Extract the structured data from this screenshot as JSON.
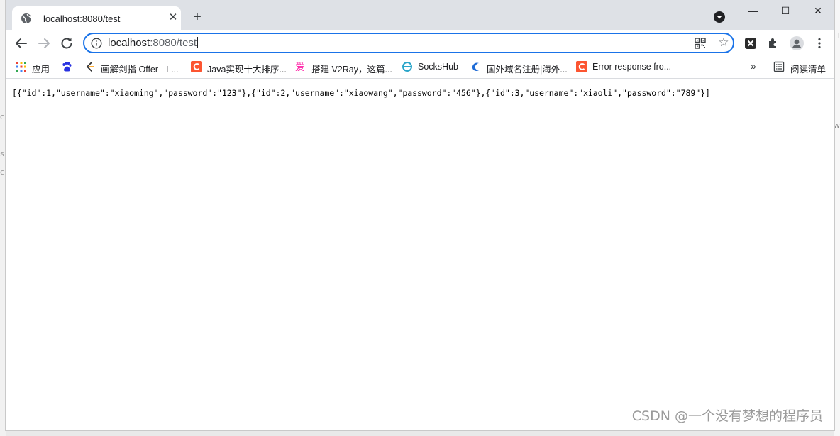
{
  "tab": {
    "title": "localhost:8080/test",
    "close_glyph": "✕"
  },
  "new_tab_glyph": "+",
  "window_controls": {
    "minimize": "—",
    "maximize": "☐",
    "close": "✕"
  },
  "address_bar": {
    "host": "localhost",
    "path": ":8080/test"
  },
  "bookmarks": [
    {
      "label": "应用",
      "icon": "apps-grid-icon"
    },
    {
      "label": "",
      "icon": "baidu-paw-icon"
    },
    {
      "label": "画解剑指 Offer - L...",
      "icon": "leetcode-icon"
    },
    {
      "label": "Java实现十大排序...",
      "icon": "csdn-icon"
    },
    {
      "label": "搭建 V2Ray，这篇...",
      "icon": "love-icon"
    },
    {
      "label": "SocksHub",
      "icon": "sockshub-icon"
    },
    {
      "label": "国外域名注册|海外...",
      "icon": "domain-icon"
    },
    {
      "label": "Error response fro...",
      "icon": "csdn-icon"
    }
  ],
  "bookmarks_overflow": "»",
  "reading_list": "阅读清单",
  "page": {
    "json_text": "[{\"id\":1,\"username\":\"xiaoming\",\"password\":\"123\"},{\"id\":2,\"username\":\"xiaowang\",\"password\":\"456\"},{\"id\":3,\"username\":\"xiaoli\",\"password\":\"789\"}]"
  },
  "watermark": "CSDN @一个没有梦想的程序员",
  "colors": {
    "accent": "#1a73e8",
    "tabstrip": "#dee1e6",
    "csdn": "#fc5531"
  }
}
